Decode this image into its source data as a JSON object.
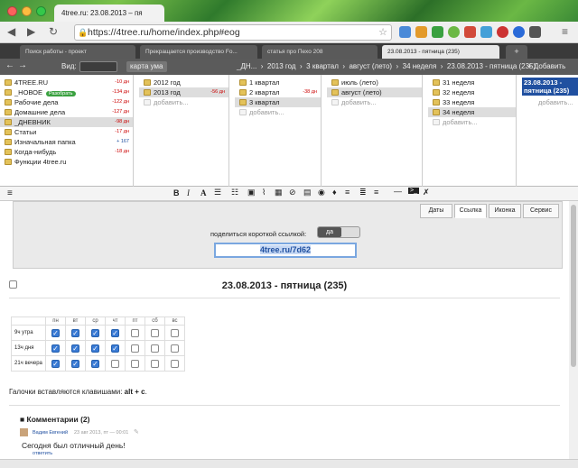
{
  "browser": {
    "tab_title": "4tree.ru: 23.08.2013 – пя",
    "url": "https://4tree.ru/home/index.php#eog",
    "bookmark_tabs": [
      "Поиск работы - проект",
      "Прекращается производство Fo...",
      "статья про Пехо 208",
      "23.08.2013 - пятница (235)"
    ]
  },
  "toolbar": {
    "view_label": "Вид:",
    "mindmap_label": "карта ума",
    "breadcrumb": [
      "_ДН...",
      "2013 год",
      "3 квартал",
      "август (лето)",
      "34 неделя",
      "23.08.2013 - пятница (235)"
    ],
    "add_label": "+ Добавить"
  },
  "tree": {
    "col1": [
      {
        "label": "4TREE.RU",
        "num": "-10 дн"
      },
      {
        "label": "_НОВОЕ",
        "badge": "Разобрать",
        "num": "-134 дн"
      },
      {
        "label": "Рабочие дела",
        "num": "-122 дн"
      },
      {
        "label": "Домашние дела",
        "num": "-127 дн"
      },
      {
        "label": "_ДНЕВНИК",
        "num": "-98 дн"
      },
      {
        "label": "Статьи",
        "num": "-17 дн"
      },
      {
        "label": "Изначальная папка",
        "num": "+ 167"
      },
      {
        "label": "Когда-нибудь",
        "num": "-18 дн"
      },
      {
        "label": "Функции 4tree.ru",
        "num": ""
      }
    ],
    "col2": [
      {
        "label": "2012 год",
        "num": ""
      },
      {
        "label": "2013 год",
        "num": "-56 дн"
      },
      {
        "label": "добавить...",
        "num": ""
      }
    ],
    "col3": [
      {
        "label": "1 квартал",
        "num": ""
      },
      {
        "label": "2 квартал",
        "num": "-38 дн"
      },
      {
        "label": "3 квартал",
        "num": ""
      },
      {
        "label": "добавить...",
        "num": ""
      }
    ],
    "col4": [
      {
        "label": "июль (лето)",
        "num": ""
      },
      {
        "label": "август (лето)",
        "num": ""
      },
      {
        "label": "добавить...",
        "num": ""
      }
    ],
    "col5": [
      {
        "label": "31 неделя",
        "num": ""
      },
      {
        "label": "32 неделя",
        "num": ""
      },
      {
        "label": "33 неделя",
        "num": ""
      },
      {
        "label": "34 неделя",
        "num": ""
      },
      {
        "label": "добавить...",
        "num": ""
      }
    ],
    "col6_selected": "23.08.2013 - пятница (235)",
    "col6_add": "добавить..."
  },
  "share": {
    "tabs": [
      "Даты",
      "Ссылка",
      "Иконка",
      "Сервис"
    ],
    "label": "поделиться короткой ссылкой:",
    "toggle_on": "да",
    "short_link": "4tree.ru/7d62"
  },
  "note": {
    "title": "23.08.2013 - пятница (235)",
    "days": [
      "пн",
      "вт",
      "ср",
      "чт",
      "пт",
      "сб",
      "вс"
    ],
    "rows": [
      {
        "label": "9ч утра",
        "checks": [
          true,
          true,
          true,
          true,
          false,
          false,
          false
        ]
      },
      {
        "label": "13ч дня",
        "checks": [
          true,
          true,
          true,
          true,
          false,
          false,
          false
        ]
      },
      {
        "label": "21ч вечера",
        "checks": [
          true,
          true,
          true,
          false,
          false,
          false,
          false
        ]
      }
    ],
    "hint_prefix": "Галочки вставляются клавишами:",
    "hint_keys": "alt + c",
    "hint_suffix": "."
  },
  "comments": {
    "header": "Комментарии (2)",
    "author": "Вадим Евгений",
    "date": "23 авг 2013, пт — 00:01",
    "text": "Сегодня был отличный день!",
    "reply": "ответить"
  },
  "colors": {
    "accent": "#2050a0",
    "selected_tree": "#ddd"
  }
}
